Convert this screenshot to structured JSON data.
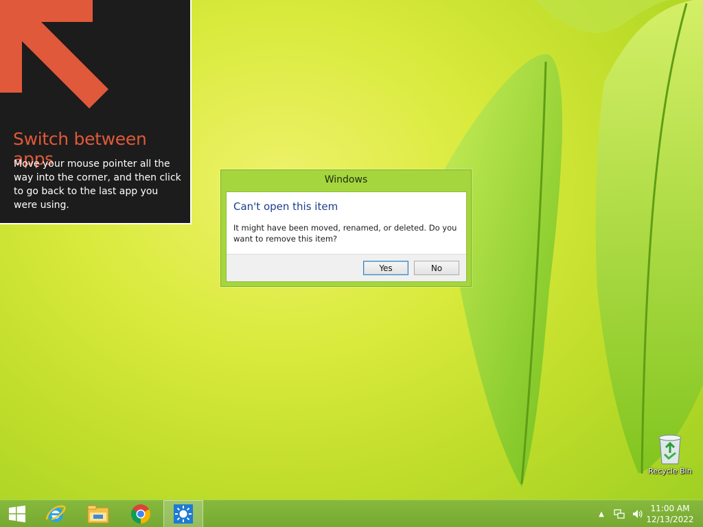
{
  "hint": {
    "title": "Switch between apps",
    "body": "Move your mouse pointer all the way into the corner, and then click to go back to the last app you were using."
  },
  "dialog": {
    "title": "Windows",
    "heading": "Can't open this item",
    "message": "It might have been moved, renamed, or deleted. Do you want to remove this item?",
    "yes_label": "Yes",
    "no_label": "No"
  },
  "desktop": {
    "recycle_bin_label": "Recycle Bin"
  },
  "taskbar": {
    "pinned": [
      "start-icon",
      "internet-explorer-icon",
      "file-explorer-icon",
      "chrome-icon",
      "app-icon"
    ],
    "tray_icons": [
      "show-hidden-icons-chevron",
      "network-icon",
      "volume-icon"
    ]
  },
  "clock": {
    "time": "11:00 AM",
    "date": "12/13/2022"
  },
  "colors": {
    "accent_orange": "#e0593a",
    "dialog_frame": "#a5d63e",
    "taskbar": "#80b337",
    "heading_blue": "#1b3d8c"
  }
}
